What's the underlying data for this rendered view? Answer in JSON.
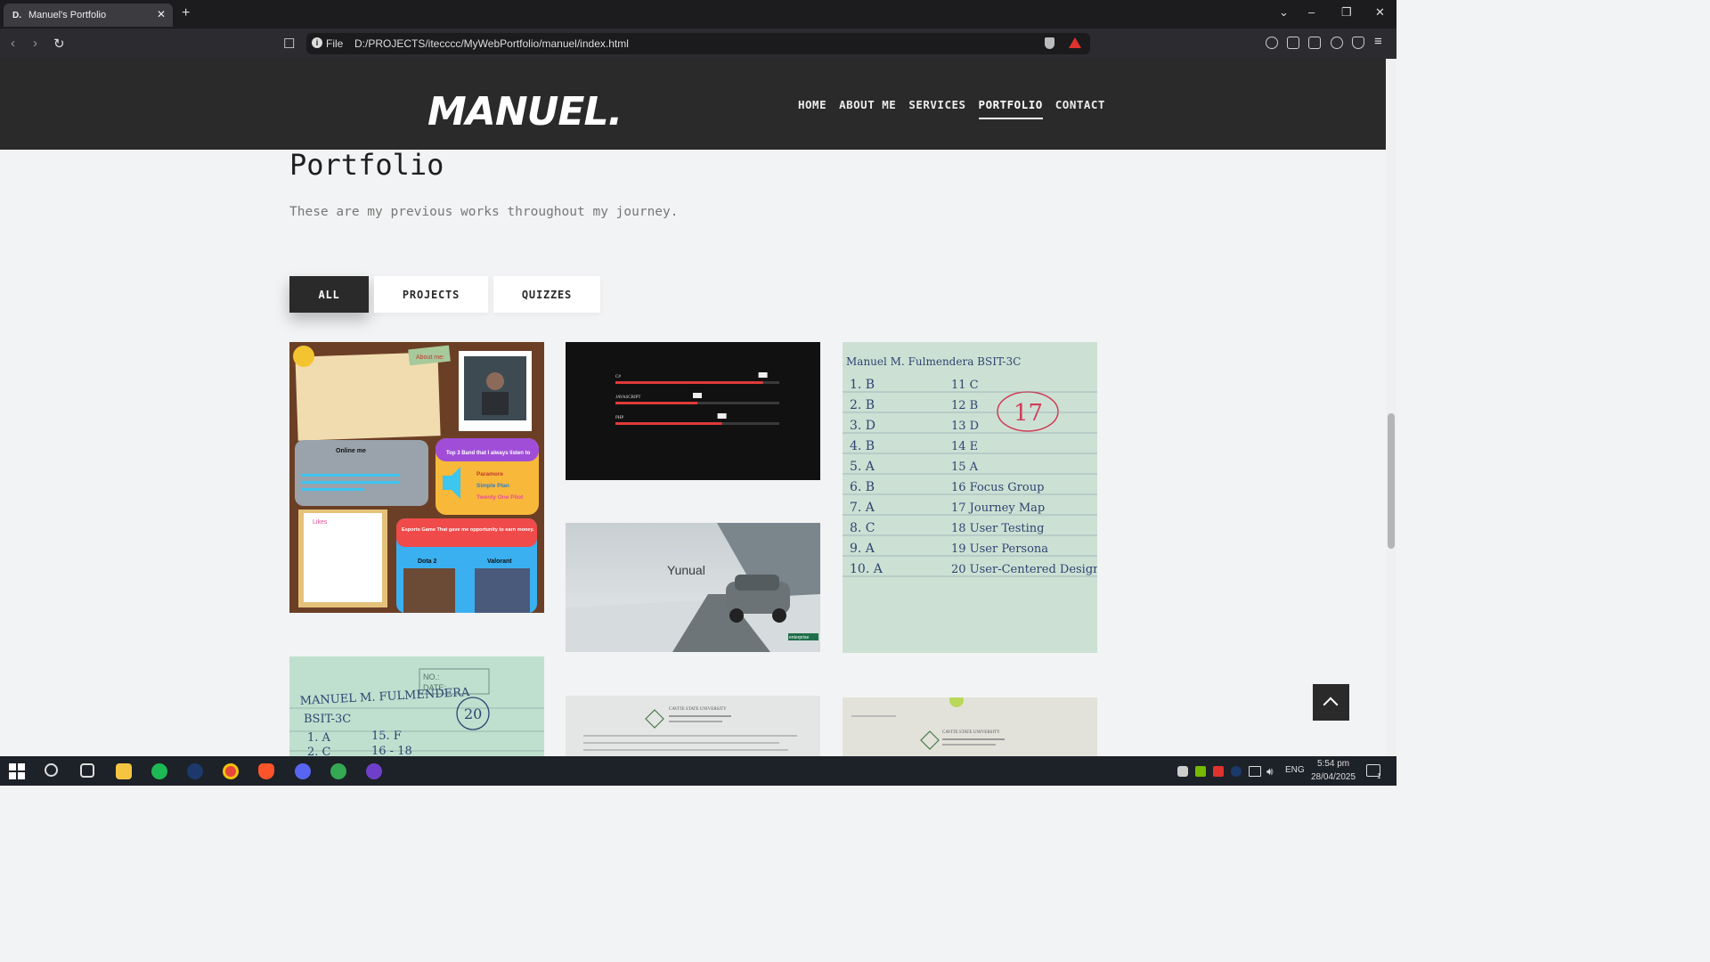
{
  "browser": {
    "tab": {
      "favicon": "D.",
      "title": "Manuel's Portfolio",
      "close": "✕"
    },
    "new_tab": "+",
    "window_controls": {
      "dropdown": "⌄",
      "minimize": "–",
      "restore": "❐",
      "close": "✕"
    },
    "url": {
      "scheme_label": "File",
      "path": "D:/PROJECTS/itecccc/MyWebPortfolio/manuel/index.html"
    }
  },
  "site": {
    "logo": "MANUEL.",
    "nav": [
      "HOME",
      "ABOUT ME",
      "SERVICES",
      "PORTFOLIO",
      "CONTACT"
    ],
    "active_nav": "PORTFOLIO"
  },
  "section": {
    "title": "Portfolio",
    "subtitle": "These are my previous works throughout my journey."
  },
  "filters": [
    "ALL",
    "PROJECTS",
    "QUIZZES"
  ],
  "active_filter": "ALL",
  "works": {
    "about_board": {
      "about_tag": "About me:",
      "online": "Online me",
      "bands_title": "Top 3 Band that I always listen to",
      "bands": [
        "Paramore",
        "Simple Plan",
        "Twenty One Pilot"
      ],
      "likes": "Likes",
      "esports_title": "Esports Game That gave me opportunity to earn money.",
      "games": [
        "Dota 2",
        "Valorant"
      ]
    },
    "skills": [
      {
        "name": "C#",
        "level": 0.9
      },
      {
        "name": "JAVASCRIPT",
        "level": 0.5
      },
      {
        "name": "PHP",
        "level": 0.65
      }
    ],
    "car_site": {
      "brand": "Yunual",
      "badge": "enterprise"
    },
    "quiz_sheet": {
      "header": "Manuel M. Fulmendera BSIT-3C",
      "score": "17",
      "left": [
        "1. B",
        "2. B",
        "3. D",
        "4. B",
        "5. A",
        "6. B",
        "7. A",
        "8. C",
        "9. A",
        "10. A"
      ],
      "right": [
        "11 C",
        "12 B",
        "13 D",
        "14 E",
        "15 A",
        "16 Focus Group",
        "17 Journey Map",
        "18 User Testing",
        "19 User Persona",
        "20 User-Centered Design"
      ]
    },
    "quiz_sheet_2": {
      "header": "MANUEL M. FULMENDERA",
      "section": "BSIT-3C",
      "score": "20",
      "no": "NO.:",
      "date": "DATE:",
      "lines": [
        "1. A",
        "2. C"
      ],
      "right": [
        "15. F",
        "16 - 18"
      ]
    },
    "doc_title": "CAVITE STATE UNIVERSITY"
  },
  "taskbar": {
    "lang": "ENG",
    "time": "5:54 pm",
    "date": "28/04/2025",
    "notifications": "1"
  }
}
